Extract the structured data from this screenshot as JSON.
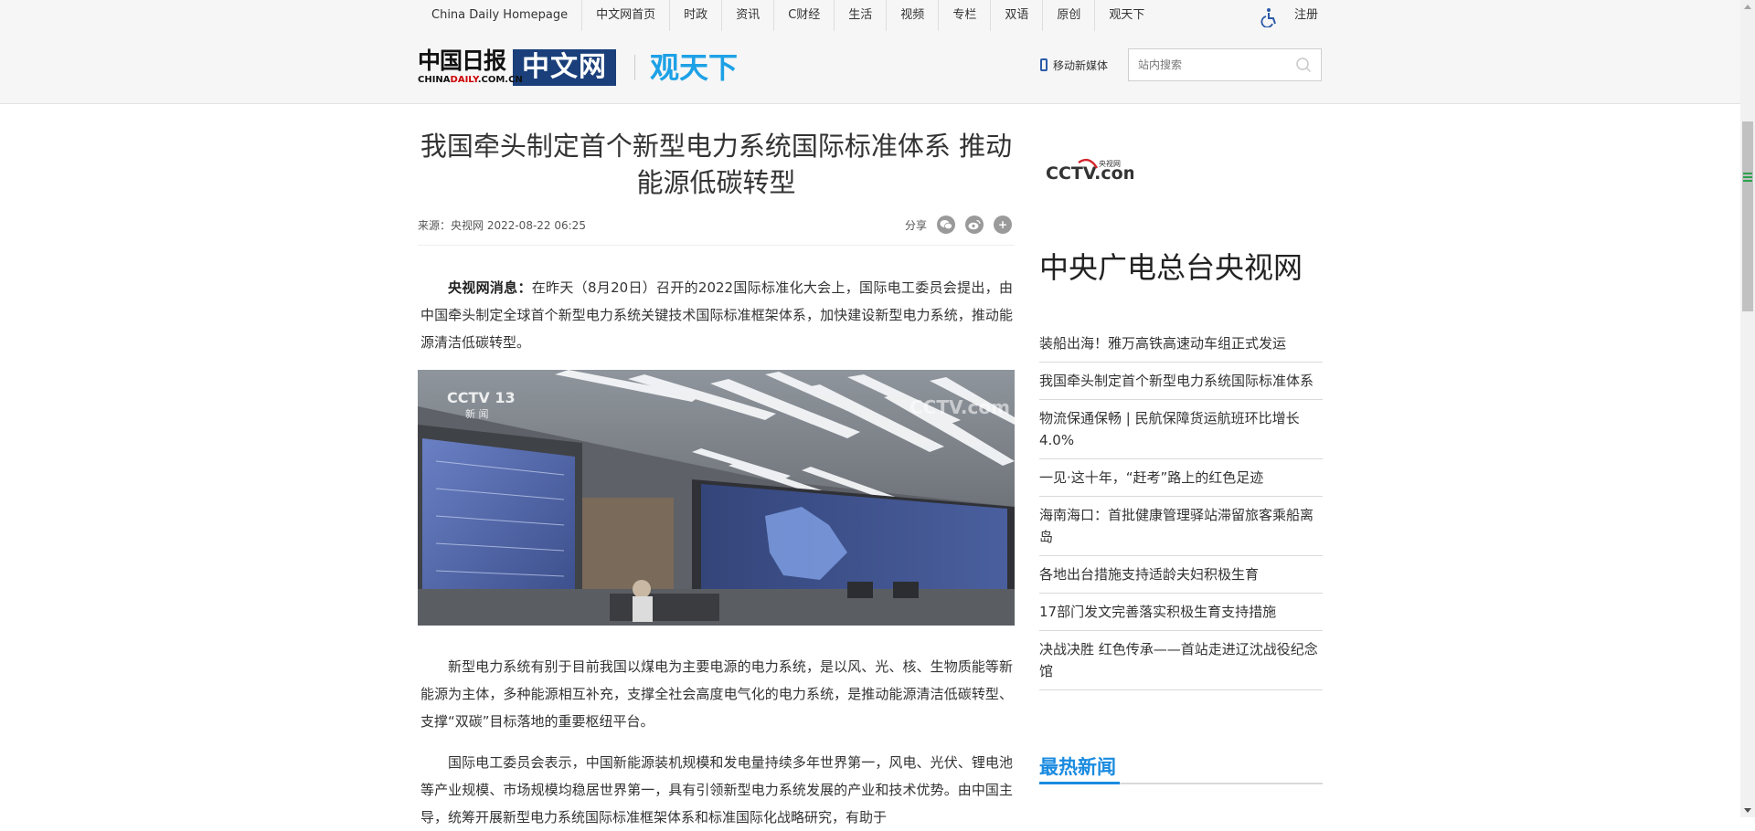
{
  "nav": {
    "items": [
      "China Daily Homepage",
      "中文网首页",
      "时政",
      "资讯",
      "C财经",
      "生活",
      "视频",
      "专栏",
      "双语",
      "原创",
      "观天下"
    ],
    "register": "注册"
  },
  "header": {
    "logo_cn": "中国日报",
    "logo_en_prefix": "CHINA",
    "logo_en_mid": "DAILY",
    "logo_en_suffix": ".COM.CN",
    "logo_zw": "中文网",
    "section": "观天下",
    "mobile_label": "移动新媒体",
    "search_placeholder": "站内搜索"
  },
  "article": {
    "title": "我国牵头制定首个新型电力系统国际标准体系 推动能源低碳转型",
    "meta": "来源：央视网 2022-08-22 06:25",
    "share_label": "分享",
    "lead_strong": "央视网消息：",
    "lead": "在昨天（8月20日）召开的2022国际标准化大会上，国际电工委员会提出，由中国牵头制定全球首个新型电力系统关键技术国际标准框架体系，加快建设新型电力系统，推动能源清洁低碳转型。",
    "para2": "新型电力系统有别于目前我国以煤电为主要电源的电力系统，是以风、光、核、生物质能等新能源为主体，多种能源相互补充，支撑全社会高度电气化的电力系统，是推动能源清洁低碳转型、支撑“双碳”目标落地的重要枢纽平台。",
    "para3": "国际电工委员会表示，中国新能源装机规模和发电量持续多年世界第一，风电、光伏、锂电池等产业规模、市场规模均稳居世界第一，具有引领新型电力系统发展的产业和技术优势。由中国主导，统筹开展新型电力系统国际标准框架体系和标准国际化战略研究，有助于",
    "photo_watermark_left": "CCTV 13",
    "photo_watermark_left_sub": "新 闻",
    "photo_watermark_right": "CCTV.com"
  },
  "sidebar": {
    "source_logo": "CCTV.com",
    "source_logo_small": "央视网",
    "source_name": "中央广电总台央视网",
    "news": [
      "装船出海！雅万高铁高速动车组正式发运",
      "我国牵头制定首个新型电力系统国际标准体系",
      "物流保通保畅 | 民航保障货运航班环比增长4.0%",
      "一见·这十年，“赶考”路上的红色足迹",
      "海南海口：首批健康管理驿站滞留旅客乘船离岛",
      "各地出台措施支持适龄夫妇积极生育",
      "17部门发文完善落实积极生育支持措施",
      "决战决胜 红色传承——首站走进辽沈战役纪念馆"
    ],
    "hot_title": "最热新闻"
  },
  "colors": {
    "accent": "#1a8be0",
    "section": "#1da1e6",
    "logo_bg": "#1a3f7a"
  }
}
